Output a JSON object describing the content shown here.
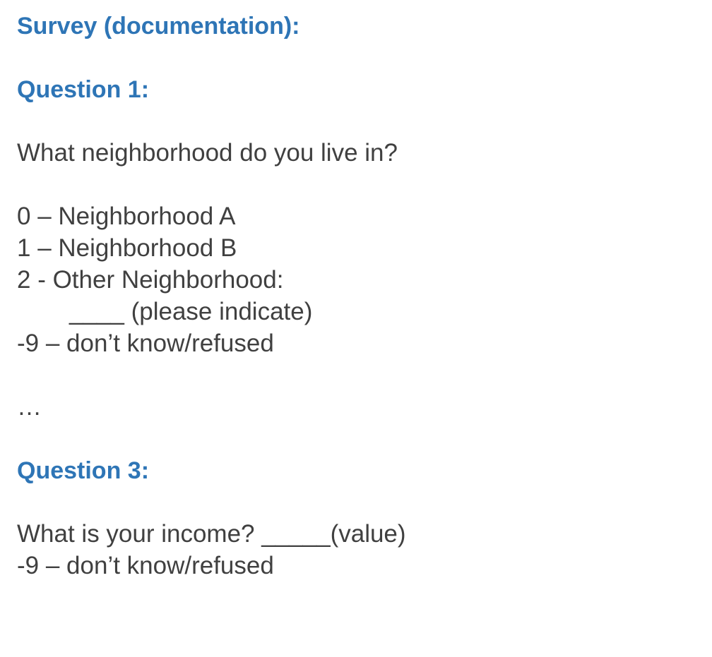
{
  "title": "Survey (documentation):",
  "question1": {
    "heading": "Question 1:",
    "prompt": "What neighborhood do you live in?",
    "options": [
      "0 – Neighborhood A",
      "1 – Neighborhood B",
      "2 - Other Neighborhood:",
      "____ (please indicate)",
      "-9 – don’t know/refused"
    ]
  },
  "ellipsis": "…",
  "question3": {
    "heading": "Question 3:",
    "prompt": "What is your income? _____(value)",
    "options": [
      "-9 – don’t know/refused"
    ]
  }
}
